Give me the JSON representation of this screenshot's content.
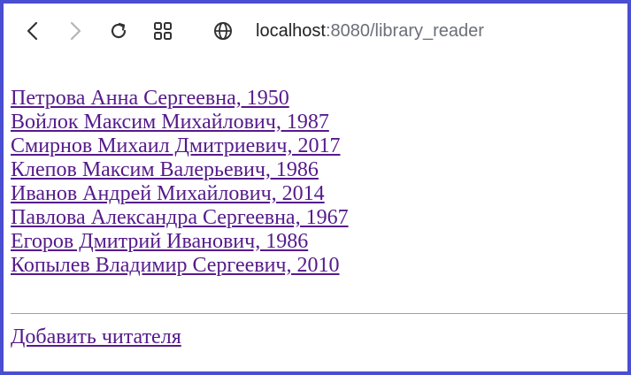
{
  "browser": {
    "url_host": "localhost",
    "url_rest": ":8080/library_reader",
    "icons": {
      "back": "back-arrow-icon",
      "forward": "forward-arrow-icon",
      "reload": "reload-icon",
      "tabs": "tab-grid-icon",
      "site_info": "globe-icon"
    }
  },
  "readers": [
    "Петрова Анна Сергеевна, 1950",
    "Войлок Максим Михайлович, 1987",
    "Смирнов Михаил Дмитриевич, 2017",
    "Клепов Максим Валерьевич, 1986",
    "Иванов Андрей Михайлович, 2014",
    "Павлова Александра Сергеевна, 1967",
    "Егоров Дмитрий Иванович, 1986",
    "Копылев Владимир Сергеевич, 2010"
  ],
  "add_reader_label": "Добавить читателя",
  "colors": {
    "frame_border": "#4a4ed0",
    "link_visited": "#551a8b"
  }
}
